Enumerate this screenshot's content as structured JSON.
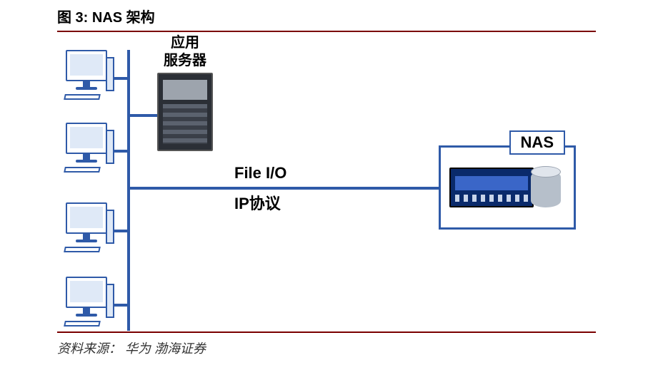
{
  "figure": {
    "caption": "图 3: NAS 架构",
    "source_label": "资料来源：",
    "source_value": "华为 渤海证券"
  },
  "diagram": {
    "server_label_line1": "应用",
    "server_label_line2": "服务器",
    "protocol_line1": "File  I/O",
    "protocol_line2": "IP协议",
    "nas_label": "NAS",
    "client_count": 4
  }
}
